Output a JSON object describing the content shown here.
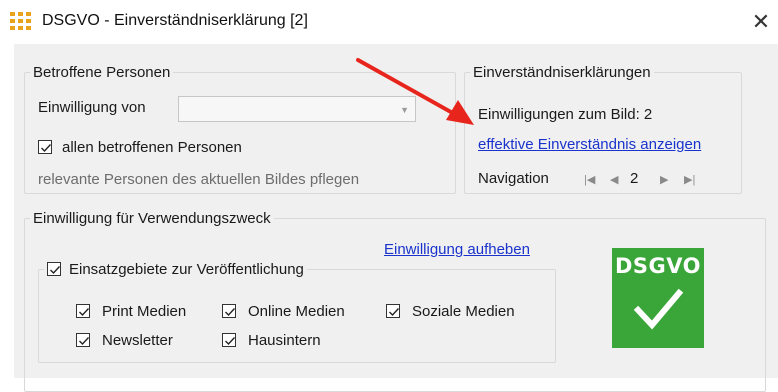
{
  "window": {
    "title": "DSGVO - Einverständniserklärung [2]",
    "close_glyph": "✕"
  },
  "betroffene": {
    "legend": "Betroffene Personen",
    "label_von": "Einwilligung von",
    "combo_value": "",
    "checkbox_all_label": "allen betroffenen Personen",
    "checkbox_all_checked": true,
    "hint": "relevante Personen des aktuellen Bildes pflegen"
  },
  "einverst": {
    "legend": "Einverständniserklärungen",
    "count_text": "Einwilligungen zum Bild: 2",
    "link_effektive": "effektive Einverständnis anzeigen",
    "nav_label": "Navigation",
    "nav_value": "2"
  },
  "verwendung": {
    "legend": "Einwilligung für Verwendungszweck",
    "link_aufheben": "Einwilligung aufheben",
    "einsatz_label": "Einsatzgebiete zur Veröffentlichung",
    "options": [
      {
        "label": "Print Medien",
        "checked": true
      },
      {
        "label": "Online Medien",
        "checked": true
      },
      {
        "label": "Soziale Medien",
        "checked": true
      },
      {
        "label": "Newsletter",
        "checked": true
      },
      {
        "label": "Hausintern",
        "checked": true
      }
    ]
  },
  "badge": {
    "text": "DSGVO",
    "color": "#3aa63a"
  },
  "colors": {
    "arrow": "#e8251c",
    "link": "#1a33cc",
    "icon": "#e8a21c"
  },
  "icons": [
    "app-icon",
    "close-icon",
    "chevron-down-icon",
    "nav-first-icon",
    "nav-prev-icon",
    "nav-next-icon",
    "nav-last-icon",
    "check-icon",
    "red-arrow-icon"
  ]
}
